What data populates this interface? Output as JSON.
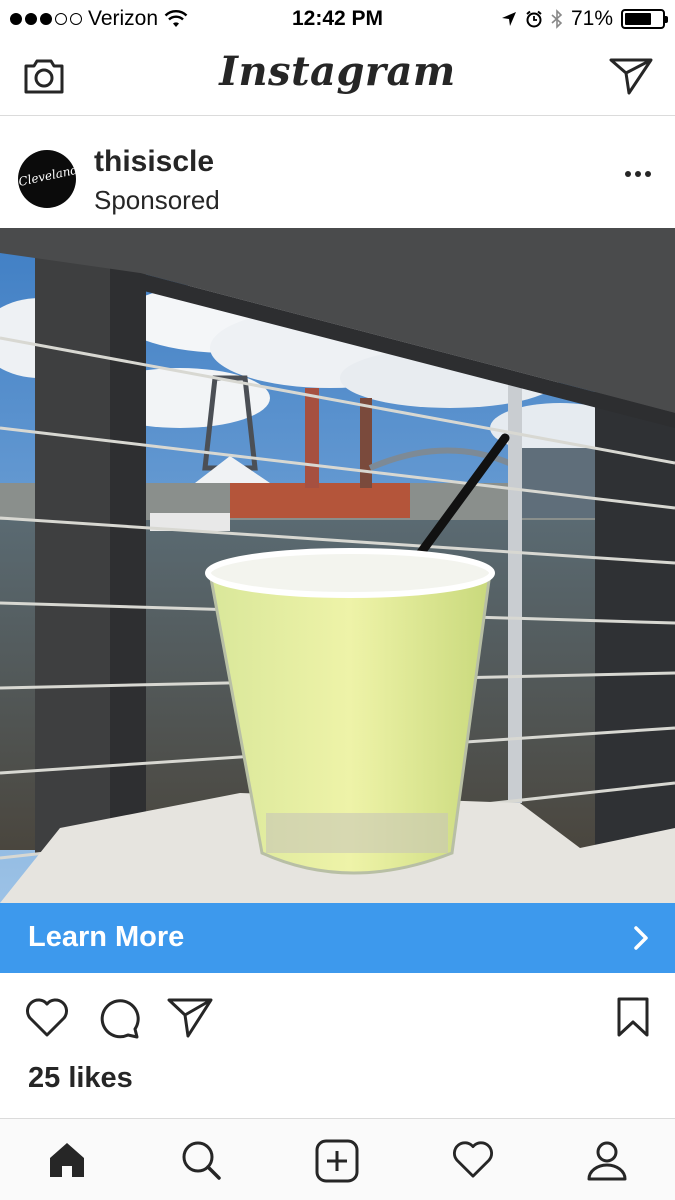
{
  "status_bar": {
    "carrier": "Verizon",
    "time": "12:42 PM",
    "battery_percent": "71%",
    "battery_level": 0.71,
    "signal_bars_filled": 3,
    "signal_bars_total": 5
  },
  "header": {
    "logo_text": "Instagram",
    "icons": [
      "camera-icon",
      "direct-message-icon"
    ]
  },
  "post": {
    "username": "thisiscle",
    "subtitle": "Sponsored",
    "avatar_text": "Cleveland",
    "cta_label": "Learn More",
    "likes": "25 likes"
  },
  "actions": {
    "icons": [
      "heart-icon",
      "comment-icon",
      "share-icon",
      "bookmark-icon"
    ]
  },
  "tabbar": {
    "icons": [
      "home-icon",
      "search-icon",
      "add-post-icon",
      "activity-heart-icon",
      "profile-icon"
    ]
  },
  "colors": {
    "accent": "#3d99ed",
    "text": "#262626",
    "divider": "#dbdbdb"
  }
}
